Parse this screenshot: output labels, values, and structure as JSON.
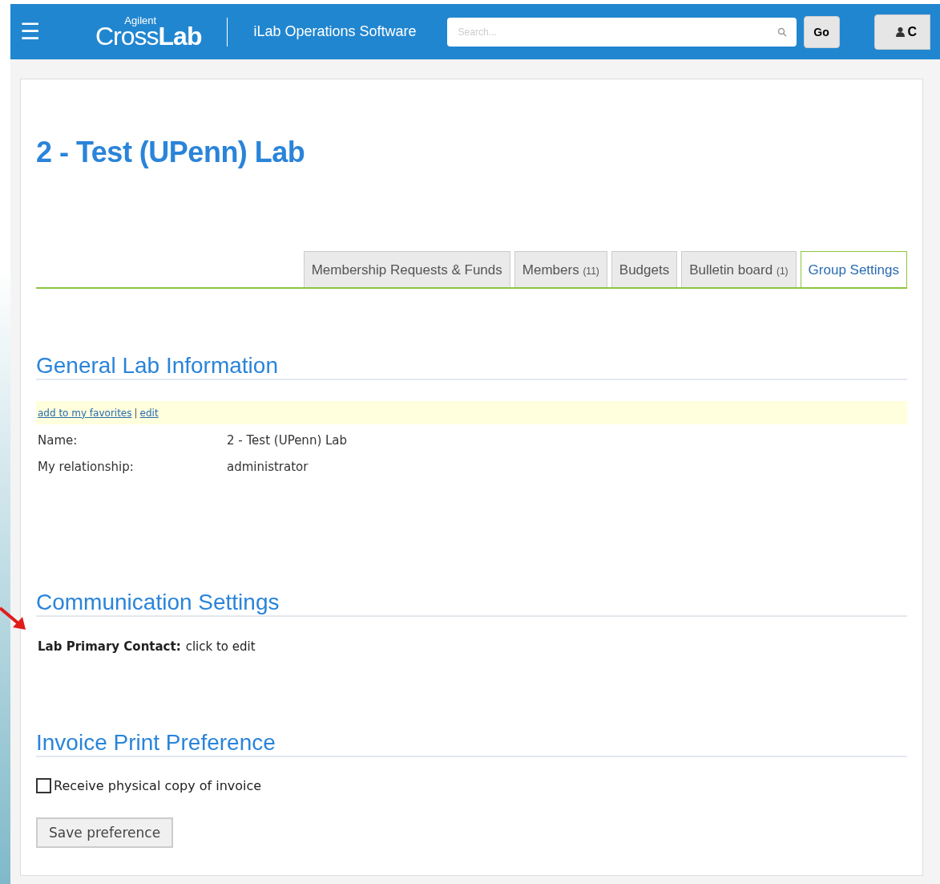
{
  "header": {
    "menu_icon": "☰",
    "logo_small": "Agilent",
    "logo_light": "Cross",
    "logo_bold": "Lab",
    "product": "iLab Operations Software",
    "search": {
      "placeholder": "Search..."
    },
    "go_button": "Go",
    "user_button": "C"
  },
  "page_title": "2 - Test (UPenn) Lab",
  "tabs": [
    {
      "label": "Membership Requests & Funds",
      "selected": false
    },
    {
      "label": "Members",
      "count": "(11)",
      "selected": false
    },
    {
      "label": "Budgets",
      "selected": false
    },
    {
      "label": "Bulletin board",
      "count": "(1)",
      "selected": false
    },
    {
      "label": "Group Settings",
      "selected": true
    }
  ],
  "general": {
    "heading": "General Lab Information",
    "links": [
      {
        "label": "add to my favorites"
      },
      {
        "label": "edit"
      }
    ],
    "separator": "|",
    "fields": [
      {
        "label": "Name:",
        "value": "2 - Test (UPenn) Lab"
      },
      {
        "label": "My relationship:",
        "value": "administrator"
      }
    ]
  },
  "communication": {
    "heading": "Communication Settings",
    "contact_label": "Lab Primary Contact:",
    "contact_value": "click to edit"
  },
  "invoice": {
    "heading": "Invoice Print Preference",
    "checkbox": {
      "label": "Receive physical copy of invoice",
      "checked": false
    },
    "save_button": "Save preference"
  }
}
